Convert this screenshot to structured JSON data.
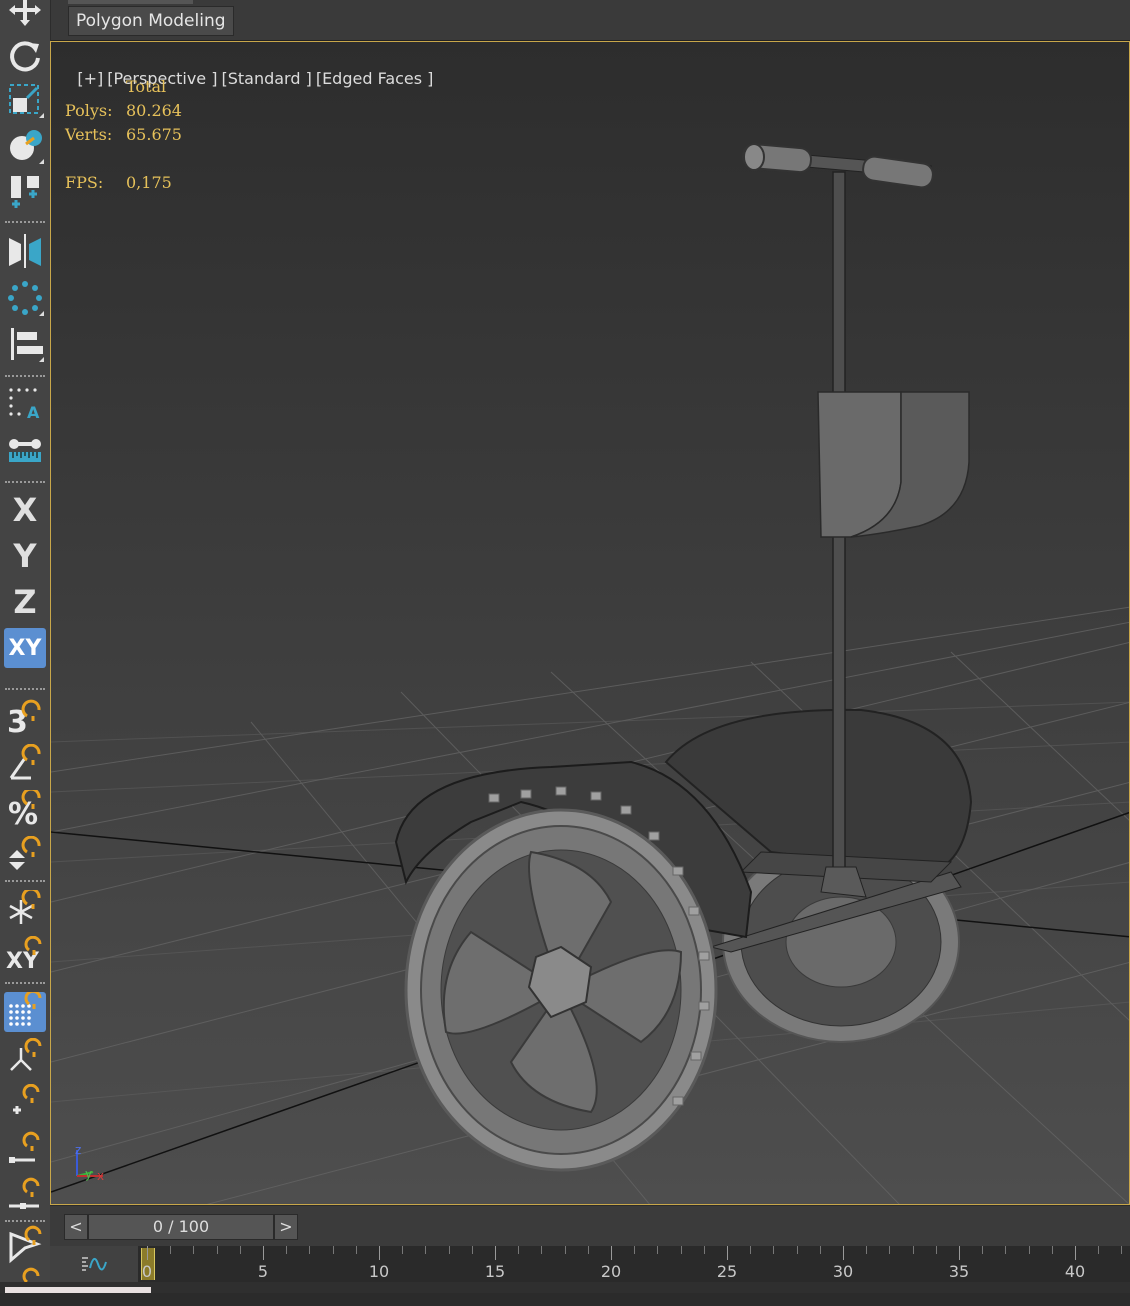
{
  "ribbon": {
    "tab_label": "Polygon Modeling"
  },
  "toolbar": {
    "items": [
      {
        "icon": "move-icon"
      },
      {
        "icon": "rotate-icon"
      },
      {
        "icon": "scale-icon"
      },
      {
        "icon": "place-icon"
      },
      {
        "icon": "create-selection-icon"
      },
      {
        "icon": "mirror-icon"
      },
      {
        "icon": "array-icon"
      },
      {
        "icon": "align-icon"
      },
      {
        "icon": "named-selection-icon"
      },
      {
        "icon": "measure-icon"
      },
      {
        "icon": "x-axis-icon",
        "label": "X"
      },
      {
        "icon": "y-axis-icon",
        "label": "Y"
      },
      {
        "icon": "z-axis-icon",
        "label": "Z"
      },
      {
        "icon": "xy-plane-icon",
        "label": "XY"
      },
      {
        "icon": "3d-snap-icon",
        "label": "3"
      },
      {
        "icon": "angle-snap-icon"
      },
      {
        "icon": "percent-snap-icon",
        "label": "%"
      },
      {
        "icon": "spinner-snap-icon"
      },
      {
        "icon": "freeze-snap-icon"
      },
      {
        "icon": "axis-constraint-snap-icon",
        "label": "XY"
      },
      {
        "icon": "grid-snap-icon"
      },
      {
        "icon": "pivot-snap-icon"
      },
      {
        "icon": "vertex-snap-icon"
      },
      {
        "icon": "edge-snap-icon"
      },
      {
        "icon": "midpoint-snap-icon"
      },
      {
        "icon": "select-filter-icon"
      }
    ]
  },
  "viewport": {
    "labels": [
      "[+]",
      "[Perspective ]",
      "[Standard ]",
      "[Edged Faces ]"
    ],
    "stats": {
      "header": "Total",
      "polys_label": "Polys:",
      "polys_value": "80.264",
      "verts_label": "Verts:",
      "verts_value": "65.675",
      "fps_label": "FPS:",
      "fps_value": "0,175"
    },
    "gizmo": {
      "z": "z",
      "y": "y",
      "x": "x"
    },
    "colors": {
      "border": "#c8a74a",
      "stats": "#e6c15a"
    }
  },
  "timeline": {
    "prev_label": "<",
    "next_label": ">",
    "frame_display": "0 / 100",
    "current_frame": 0,
    "ruler_labels": [
      "0",
      "5",
      "10",
      "15",
      "20",
      "25",
      "30",
      "35",
      "40"
    ]
  }
}
